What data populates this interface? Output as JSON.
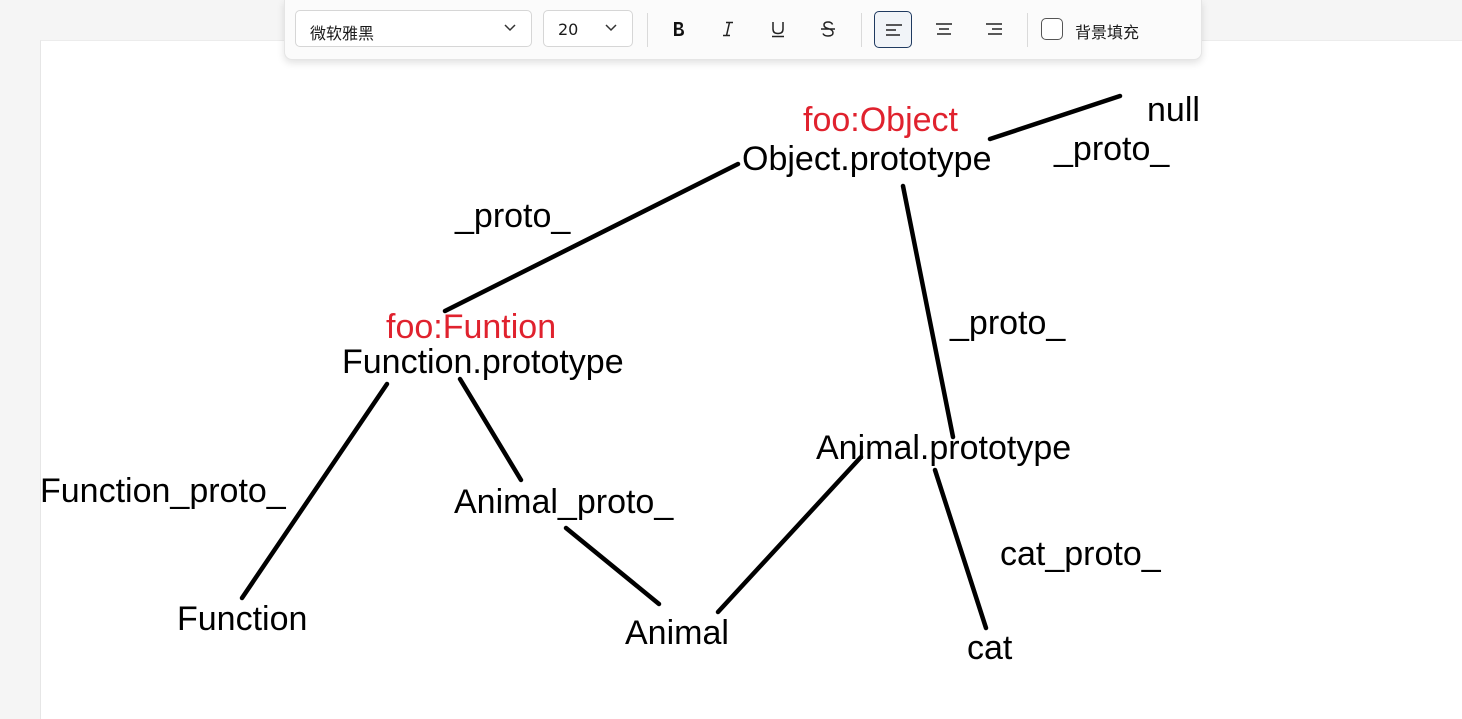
{
  "toolbar": {
    "font_family": "微软雅黑",
    "font_size": "20",
    "buttons": [
      "bold",
      "italic",
      "underline",
      "strikethrough",
      "align-left",
      "align-center",
      "align-right"
    ],
    "active_button": "align-left",
    "background_fill_label": "背景填充",
    "background_fill_checked": false
  },
  "diagram": {
    "nodes": {
      "object_tag": "foo:Object",
      "object_prototype": "Object.prototype",
      "null": "null",
      "null_edge": "_proto_",
      "object_edge": "_proto_",
      "function_tag": "foo:Funtion",
      "function_prototype": "Function.prototype",
      "animal_edge": "_proto_",
      "animal_prototype": "Animal.prototype",
      "function_proto": "Function_proto_",
      "animal_proto": "Animal_proto_",
      "cat_proto": "cat_proto_",
      "function": "Function",
      "animal": "Animal",
      "cat": "cat"
    },
    "colors": {
      "highlight": "#e0222e",
      "text": "#000000",
      "line": "#000000"
    }
  }
}
